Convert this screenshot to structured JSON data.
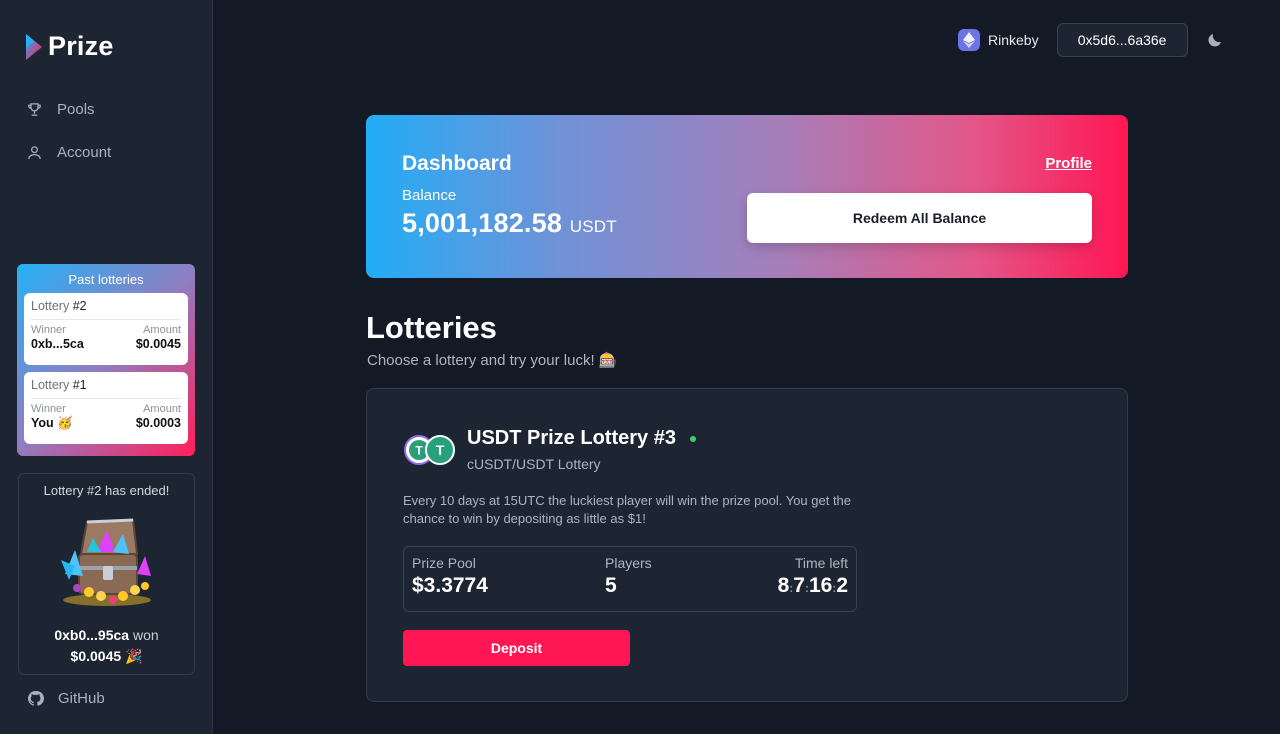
{
  "app": {
    "name": "Prize",
    "brand_color": "#ff1654"
  },
  "sidebar": {
    "items": [
      {
        "label": "Pools",
        "icon": "trophy-icon"
      },
      {
        "label": "Account",
        "icon": "user-icon"
      }
    ],
    "past_lotteries": {
      "title": "Past lotteries",
      "entries": [
        {
          "prefix": "Lottery",
          "number": "#2",
          "winner_label": "Winner",
          "amount_label": "Amount",
          "winner": "0xb...5ca",
          "amount": "$0.0045"
        },
        {
          "prefix": "Lottery",
          "number": "#1",
          "winner_label": "Winner",
          "amount_label": "Amount",
          "winner": "You 🥳",
          "amount": "$0.0003"
        }
      ]
    },
    "ended": {
      "title": "Lottery #2 has ended!",
      "winner": "0xb0...95ca",
      "won_label": "won",
      "amount": "$0.0045",
      "emoji": "🎉"
    },
    "github": {
      "label": "GitHub",
      "icon": "github-icon"
    }
  },
  "header": {
    "network": "Rinkeby",
    "network_icon": "ethereum-icon",
    "wallet": "0x5d6...6a36e",
    "theme_icon": "moon-icon"
  },
  "dashboard": {
    "title": "Dashboard",
    "balance_label": "Balance",
    "balance": "5,001,182.58",
    "unit": "USDT",
    "profile_link": "Profile",
    "redeem_button": "Redeem All Balance"
  },
  "lotteries": {
    "title": "Lotteries",
    "subtitle": "Choose a lottery and try your luck! 🎰",
    "card": {
      "title": "USDT Prize Lottery #3",
      "subtitle": "cUSDT/USDT Lottery",
      "description": "Every 10 days at 15UTC the luckiest player will win the prize pool. You get the chance to win by depositing as little as $1!",
      "prize_pool_label": "Prize Pool",
      "prize_pool": "$3.3774",
      "players_label": "Players",
      "players": "5",
      "time_left_label": "Time left",
      "time_left": {
        "days": "8",
        "hours": "7",
        "minutes": "16",
        "seconds": "2"
      },
      "deposit_button": "Deposit",
      "status": "active"
    }
  }
}
